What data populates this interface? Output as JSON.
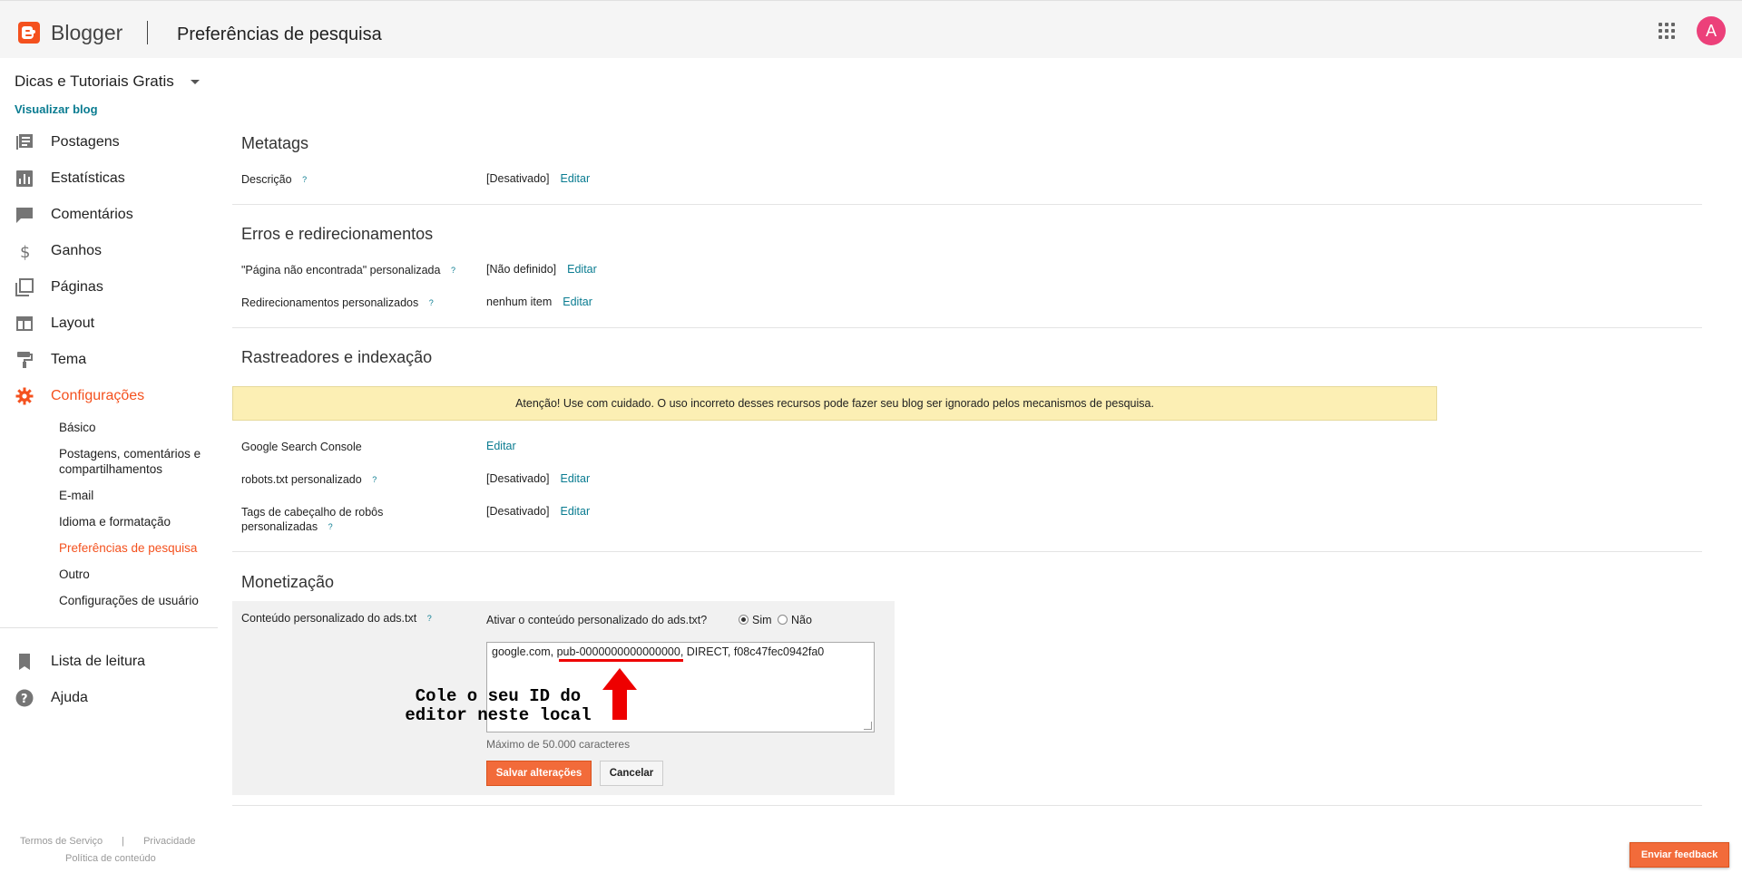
{
  "header": {
    "brand": "Blogger",
    "title": "Preferências de pesquisa",
    "avatar_letter": "A",
    "brand_color": "#f4511e",
    "avatar_color": "#ec407a"
  },
  "sidebar": {
    "blog_name": "Dicas e Tutoriais Gratis",
    "view_blog": "Visualizar blog",
    "nav": [
      {
        "label": "Postagens",
        "icon": "posts-icon"
      },
      {
        "label": "Estatísticas",
        "icon": "stats-icon"
      },
      {
        "label": "Comentários",
        "icon": "comments-icon"
      },
      {
        "label": "Ganhos",
        "icon": "dollar-icon"
      },
      {
        "label": "Páginas",
        "icon": "pages-icon"
      },
      {
        "label": "Layout",
        "icon": "layout-icon"
      },
      {
        "label": "Tema",
        "icon": "paint-roller-icon"
      },
      {
        "label": "Configurações",
        "icon": "gear-icon"
      }
    ],
    "sub_items": [
      "Básico",
      "Postagens, comentários e compartilhamentos",
      "E-mail",
      "Idioma e formatação",
      "Preferências de pesquisa",
      "Outro",
      "Configurações de usuário"
    ],
    "reading_list": "Lista de leitura",
    "help": "Ajuda",
    "footer": {
      "terms": "Termos de Serviço",
      "privacy": "Privacidade",
      "content_policy": "Política de conteúdo"
    }
  },
  "main": {
    "help_mark": "?",
    "edit": "Editar",
    "metatags": {
      "title": "Metatags",
      "description_label": "Descrição",
      "description_value": "[Desativado]"
    },
    "errors": {
      "title": "Erros e redirecionamentos",
      "not_found_label": "\"Página não encontrada\" personalizada",
      "not_found_value": "[Não definido]",
      "redirects_label": "Redirecionamentos personalizados",
      "redirects_value": "nenhum item"
    },
    "crawlers": {
      "title": "Rastreadores e indexação",
      "warning": "Atenção! Use com cuidado. O uso incorreto desses recursos pode fazer seu blog ser ignorado pelos mecanismos de pesquisa.",
      "gsc_label": "Google Search Console",
      "robots_label": "robots.txt personalizado",
      "robots_value": "[Desativado]",
      "robot_tags_label_1": "Tags de cabeçalho de robôs",
      "robot_tags_label_2": "personalizadas",
      "robot_tags_value": "[Desativado]"
    },
    "monetization": {
      "title": "Monetização",
      "ads_label": "Conteúdo personalizado do ads.txt",
      "question": "Ativar o conteúdo personalizado do ads.txt?",
      "yes": "Sim",
      "no": "Não",
      "selected": "Sim",
      "textarea_value": "google.com, pub-0000000000000000, DIRECT, f08c47fec0942fa0",
      "annotation_line1": "Cole o seu ID do",
      "annotation_line2": "editor neste local",
      "max_chars": "Máximo de 50.000 caracteres",
      "save": "Salvar alterações",
      "cancel": "Cancelar"
    },
    "feedback": "Enviar feedback"
  }
}
